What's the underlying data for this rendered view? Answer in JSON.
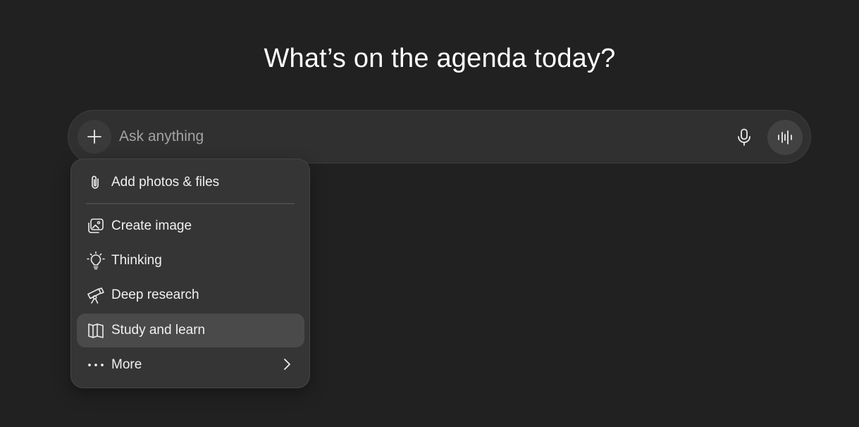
{
  "heading": "What’s on the agenda today?",
  "composer": {
    "placeholder": "Ask anything",
    "value": ""
  },
  "attach_menu": {
    "items": [
      {
        "label": "Add photos & files",
        "icon": "paperclip-icon"
      },
      {
        "label": "Create image",
        "icon": "image-icon"
      },
      {
        "label": "Thinking",
        "icon": "lightbulb-icon"
      },
      {
        "label": "Deep research",
        "icon": "telescope-icon"
      },
      {
        "label": "Study and learn",
        "icon": "book-icon",
        "highlighted": true
      },
      {
        "label": "More",
        "icon": "more-icon",
        "submenu": true
      }
    ]
  },
  "colors": {
    "background": "#212121",
    "composer": "#303030",
    "menu": "#353535",
    "menu_highlight": "#4a4a4a",
    "text": "#ececec"
  }
}
